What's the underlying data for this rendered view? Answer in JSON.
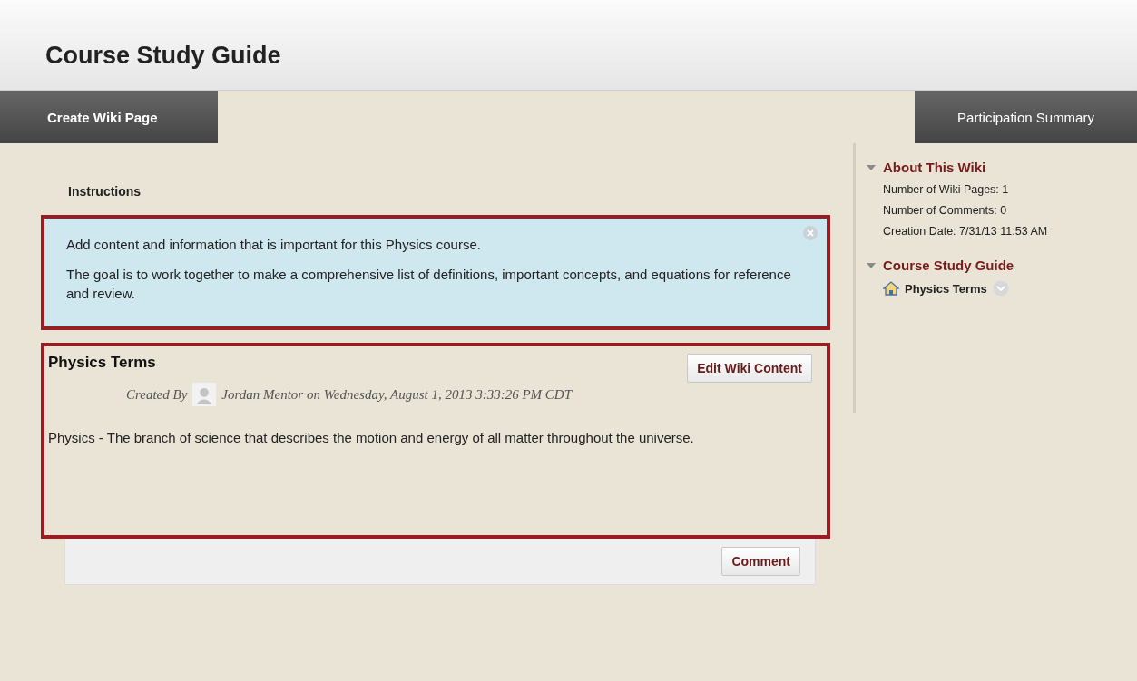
{
  "page_title": "Course Study Guide",
  "toolbar": {
    "left_button": "Create Wiki Page",
    "right_button": "Participation Summary"
  },
  "instructions": {
    "heading": "Instructions",
    "paragraphs": [
      "Add content and information that is important for this Physics course.",
      "The goal is to work together to make a comprehensive list of definitions, important concepts, and equations for reference and review."
    ]
  },
  "wiki_page": {
    "title": "Physics Terms",
    "edit_button": "Edit Wiki Content",
    "created_by_label": "Created By",
    "author_line": "Jordan Mentor on Wednesday, August 1, 2013 3:33:26 PM CDT",
    "body": "Physics - The branch of science that describes the motion and energy of all matter throughout the universe."
  },
  "comment_button": "Comment",
  "sidebar": {
    "sections": [
      {
        "title": "About This Wiki",
        "expanded": true,
        "lines": [
          "Number of Wiki Pages: 1",
          "Number of Comments: 0",
          "Creation Date: 7/31/13 11:53 AM"
        ]
      },
      {
        "title": "Course Study Guide",
        "expanded": true,
        "pages": [
          {
            "label": "Physics Terms"
          }
        ]
      }
    ]
  }
}
